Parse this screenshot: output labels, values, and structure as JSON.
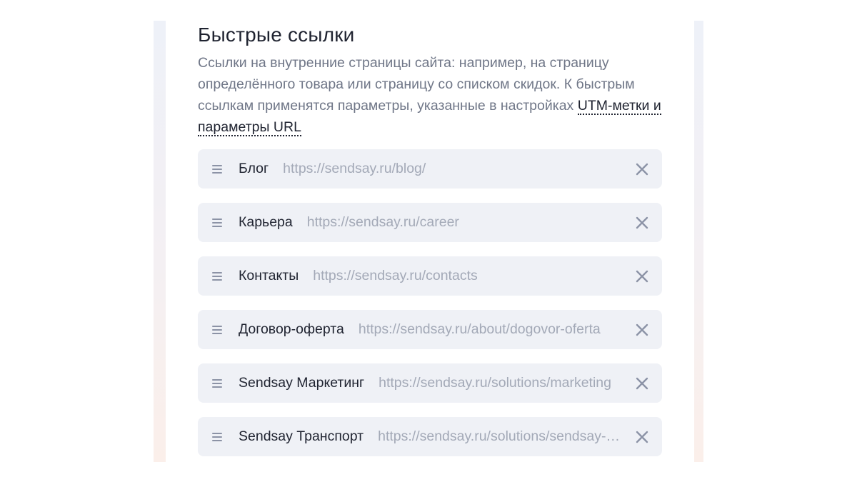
{
  "section": {
    "title": "Быстрые ссылки",
    "description_text": "Ссылки на внутренние страницы сайта: например, на страницу определённого товара или страницу со списком скидок. К быстрым ссылкам применятся параметры, указанные в настройках ",
    "utm_link_label": "UTM-метки и параметры URL"
  },
  "links": [
    {
      "name": "Блог",
      "url": "https://sendsay.ru/blog/"
    },
    {
      "name": "Карьера",
      "url": "https://sendsay.ru/career"
    },
    {
      "name": "Контакты",
      "url": "https://sendsay.ru/contacts"
    },
    {
      "name": "Договор-оферта",
      "url": "https://sendsay.ru/about/dogovor-oferta"
    },
    {
      "name": "Sendsay Маркетинг",
      "url": "https://sendsay.ru/solutions/marketing"
    },
    {
      "name": "Sendsay Транспорт",
      "url": "https://sendsay.ru/solutions/sendsay-transport"
    }
  ],
  "icons": {
    "drag": "drag-handle-icon",
    "close": "close-icon"
  },
  "colors": {
    "row_background": "#eff1f6",
    "title": "#1f2330",
    "description": "#6f7687",
    "url": "#a3a9b7",
    "icon": "#8c93a6"
  }
}
